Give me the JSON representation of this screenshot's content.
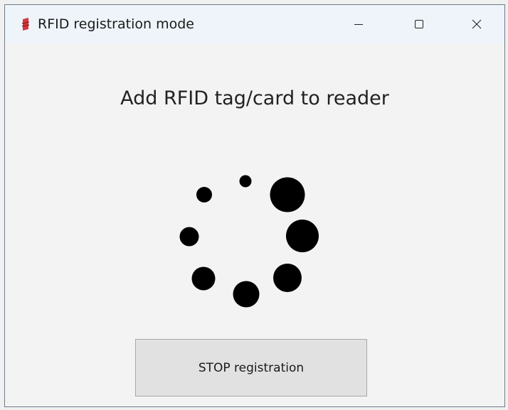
{
  "window": {
    "title": "RFID registration mode",
    "icon": "rfid-app-icon",
    "controls": {
      "minimize_icon": "minimize-icon",
      "maximize_icon": "maximize-icon",
      "close_icon": "close-icon"
    }
  },
  "main": {
    "prompt": "Add RFID tag/card to reader",
    "spinner_icon": "loading-spinner"
  },
  "actions": {
    "stop_label": "STOP registration"
  },
  "colors": {
    "titlebar": "#eef4f9",
    "window_bg": "#f3f3f3",
    "button_bg": "#e1e1e1",
    "spinner_dot": "#000000",
    "icon_red": "#d9363e"
  }
}
